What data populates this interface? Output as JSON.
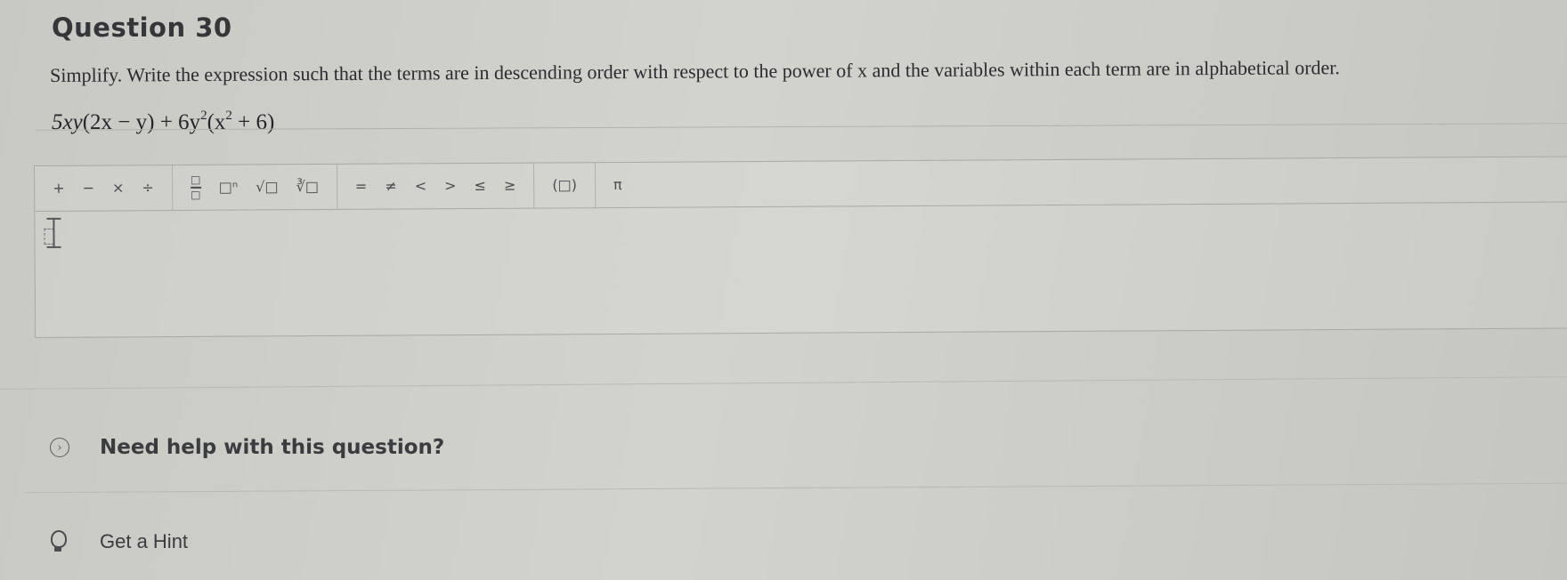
{
  "question": {
    "title": "Question 30",
    "prompt": "Simplify. Write the expression such that the terms are in descending order with respect to the power of x and the variables within each term are in alphabetical order.",
    "expression": {
      "part1": "5xy",
      "part2": "(2x − y) + 6y",
      "exp1": "2",
      "part3": "(x",
      "exp2": "2",
      "part4": " + 6)"
    }
  },
  "toolbar": {
    "ops": [
      "+",
      "−",
      "×",
      "÷"
    ],
    "fraction_icon": "fraction-icon",
    "templates": [
      "□ⁿ",
      "√□",
      "∛□"
    ],
    "relations": [
      "=",
      "≠",
      "<",
      ">",
      "≤",
      "≥"
    ],
    "parens": "(□)",
    "pi": "π"
  },
  "help": {
    "label": "Need help with this question?",
    "icon": "chevron-right-circle-icon"
  },
  "hint": {
    "label": "Get a Hint",
    "icon": "lightbulb-icon"
  }
}
